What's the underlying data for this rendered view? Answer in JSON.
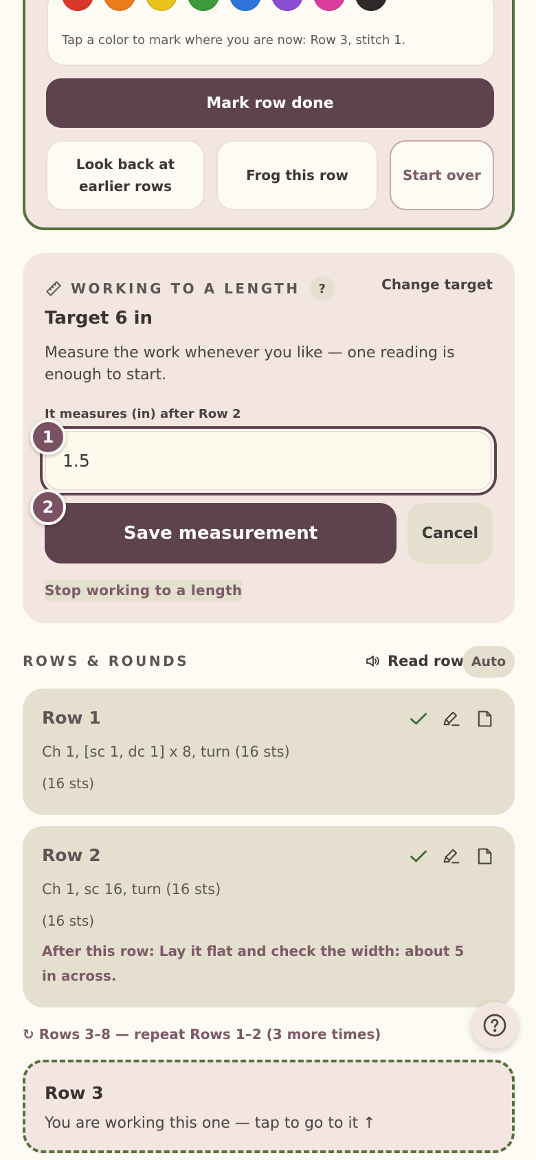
{
  "palette": {
    "colors": [
      "#d9372b",
      "#ec7b1c",
      "#e7c31d",
      "#3d9a3c",
      "#2f73dd",
      "#8a4fd2",
      "#db3d9d",
      "#2f2a2a"
    ],
    "hint": "Tap a color to mark where you are now: Row 3, stitch 1."
  },
  "actions": {
    "mark_done": "Mark row done",
    "look_back": "Look back at earlier rows",
    "frog": "Frog this row",
    "start_over": "Start over"
  },
  "length": {
    "title": "WORKING TO A LENGTH",
    "help": "?",
    "change_target": "Change target",
    "target": "Target 6 in",
    "description": "Measure the work whenever you like — one reading is enough to start.",
    "measure_label": "It measures (in) after Row 2",
    "measure_value": "1.5",
    "save": "Save measurement",
    "cancel": "Cancel",
    "stop": "Stop working to a length",
    "badge1": "1",
    "badge2": "2"
  },
  "rows": {
    "title": "ROWS & ROUNDS",
    "read_row": "Read row",
    "auto": "Auto",
    "items": [
      {
        "title": "Row 1",
        "text": "Ch 1, [sc 1, dc 1] x 8, turn (16 sts)",
        "sts": "(16 sts)"
      },
      {
        "title": "Row 2",
        "text": "Ch 1, sc 16, turn (16 sts)",
        "sts": "(16 sts)",
        "note": "After this row: Lay it flat and check the width: about 5 in across."
      }
    ],
    "repeat_note": "↻ Rows 3–8 — repeat Rows 1–2 (3 more times)",
    "current": {
      "title": "Row 3",
      "subtitle": "You are working this one — tap to go to it ↑"
    }
  },
  "icons": {
    "ruler": "ruler-icon",
    "speaker": "speaker-icon",
    "check": "check-icon",
    "highlighter": "highlighter-icon",
    "note": "note-icon",
    "help": "help-icon"
  }
}
